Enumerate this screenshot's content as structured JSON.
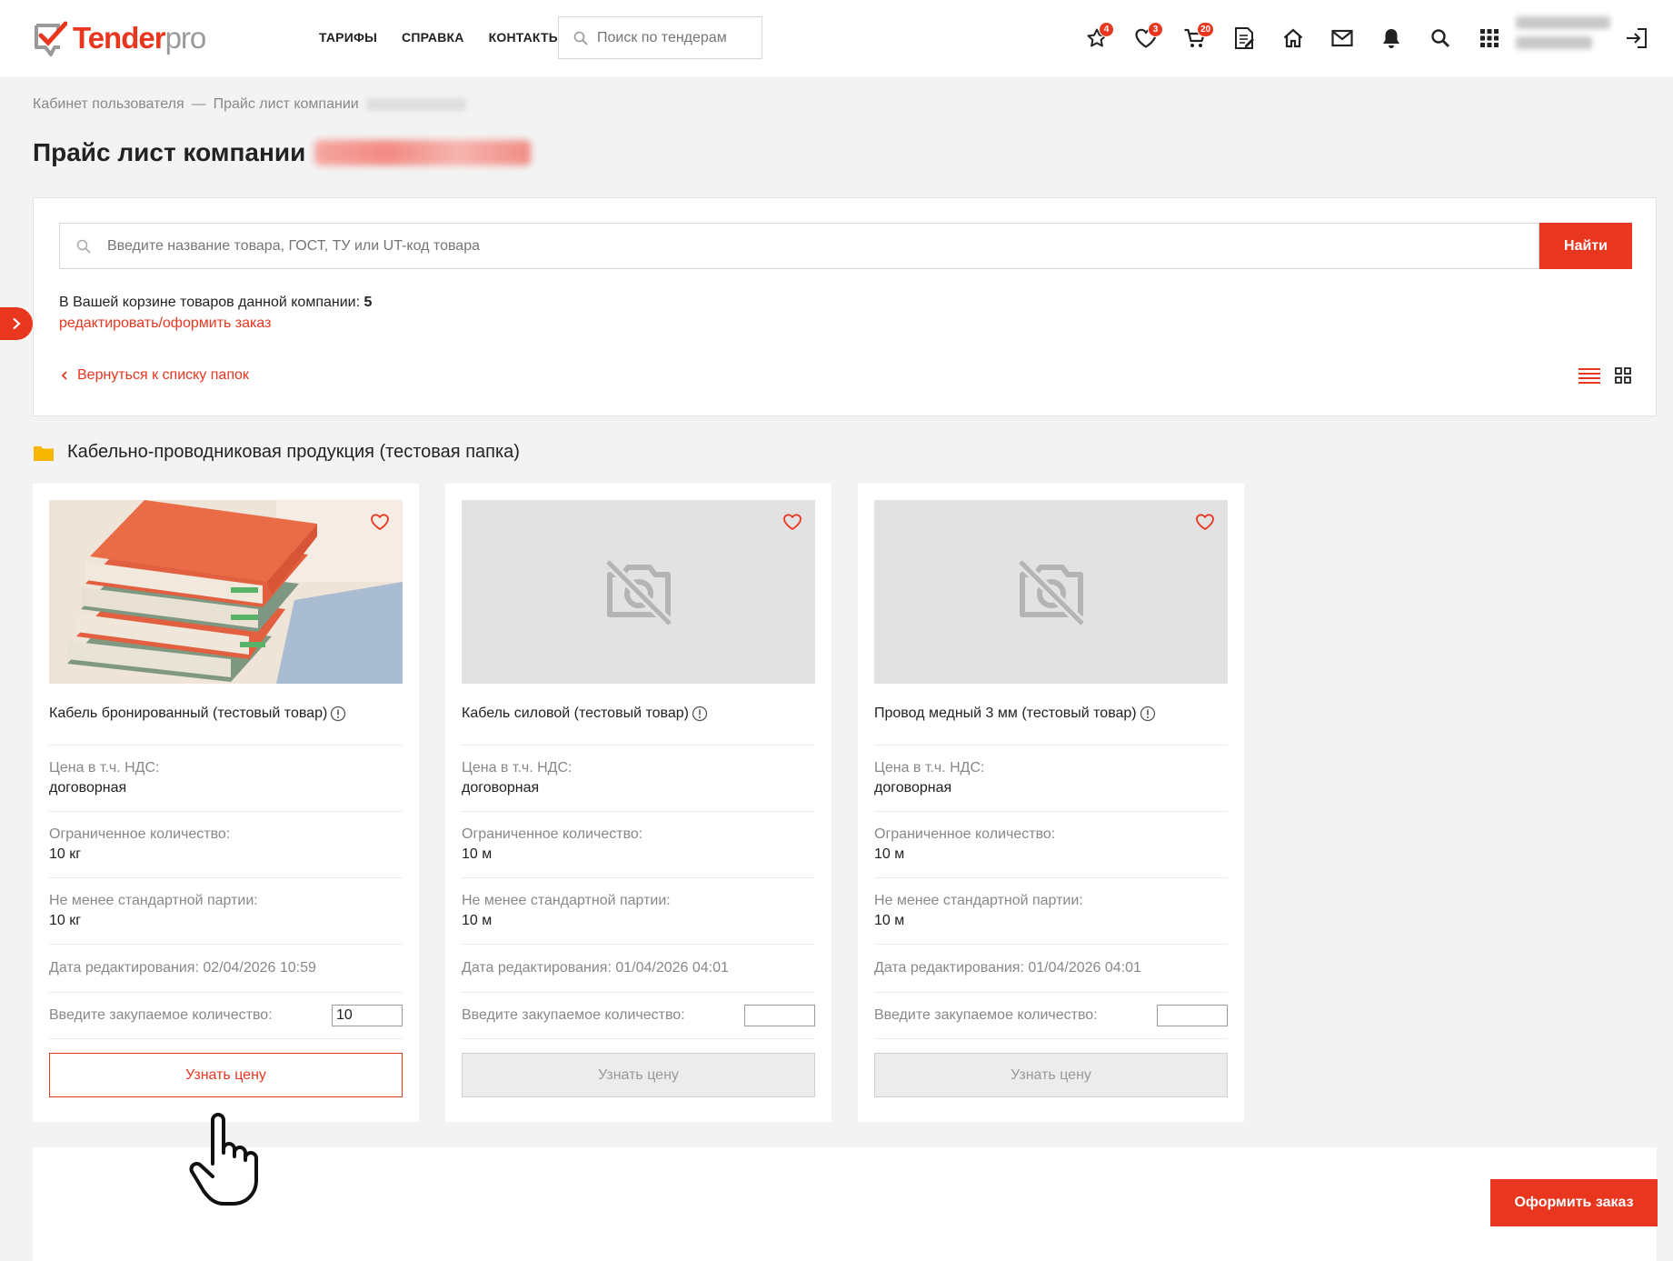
{
  "header": {
    "logo": {
      "brand": "Tender",
      "suffix": "pro"
    },
    "nav": [
      "ТАРИФЫ",
      "СПРАВКА",
      "КОНТАКТЫ"
    ],
    "search_placeholder": "Поиск по тендерам",
    "icons": [
      {
        "name": "star-icon",
        "badge": "4"
      },
      {
        "name": "heart-icon",
        "badge": "3"
      },
      {
        "name": "cart-icon",
        "badge": "20"
      },
      {
        "name": "document-icon",
        "badge": ""
      },
      {
        "name": "home-icon",
        "badge": ""
      },
      {
        "name": "mail-icon",
        "badge": ""
      },
      {
        "name": "bell-icon",
        "badge": ""
      },
      {
        "name": "search-icon",
        "badge": ""
      },
      {
        "name": "apps-grid-icon",
        "badge": ""
      }
    ]
  },
  "breadcrumb": {
    "home": "Кабинет пользователя",
    "separator": "—",
    "current": "Прайс лист компании"
  },
  "page_title": "Прайс лист компании",
  "search_panel": {
    "placeholder": "Введите название товара, ГОСТ, ТУ или UT-код товара",
    "button": "Найти",
    "cart_text": "В Вашей корзине товаров данной компании:",
    "cart_count": "5",
    "edit_link": "редактировать/оформить заказ",
    "back_link": "Вернуться к списку папок"
  },
  "folder": {
    "title": "Кабельно-проводниковая продукция (тестовая папка)"
  },
  "labels": {
    "price": "Цена в т.ч. НДС:",
    "limited": "Ограниченное количество:",
    "min_batch": "Не менее стандартной партии:",
    "qty": "Введите закупаемое количество:",
    "price_button": "Узнать цену"
  },
  "products": [
    {
      "title": "Кабель бронированный (тестовый товар)",
      "price": "договорная",
      "limited": "10 кг",
      "min_batch": "10 кг",
      "date": "Дата редактирования: 02/04/2026 10:59",
      "qty": "10",
      "has_image": true
    },
    {
      "title": "Кабель силовой (тестовый товар)",
      "price": "договорная",
      "limited": "10 м",
      "min_batch": "10 м",
      "date": "Дата редактирования: 01/04/2026 04:01",
      "qty": "",
      "has_image": false
    },
    {
      "title": "Провод медный 3 мм (тестовый товар)",
      "price": "договорная",
      "limited": "10 м",
      "min_batch": "10 м",
      "date": "Дата редактирования: 01/04/2026 04:01",
      "qty": "",
      "has_image": false
    }
  ],
  "order_button": "Оформить заказ",
  "colors": {
    "accent": "#e8361f",
    "muted": "#888888",
    "background": "#f3f3f3"
  }
}
